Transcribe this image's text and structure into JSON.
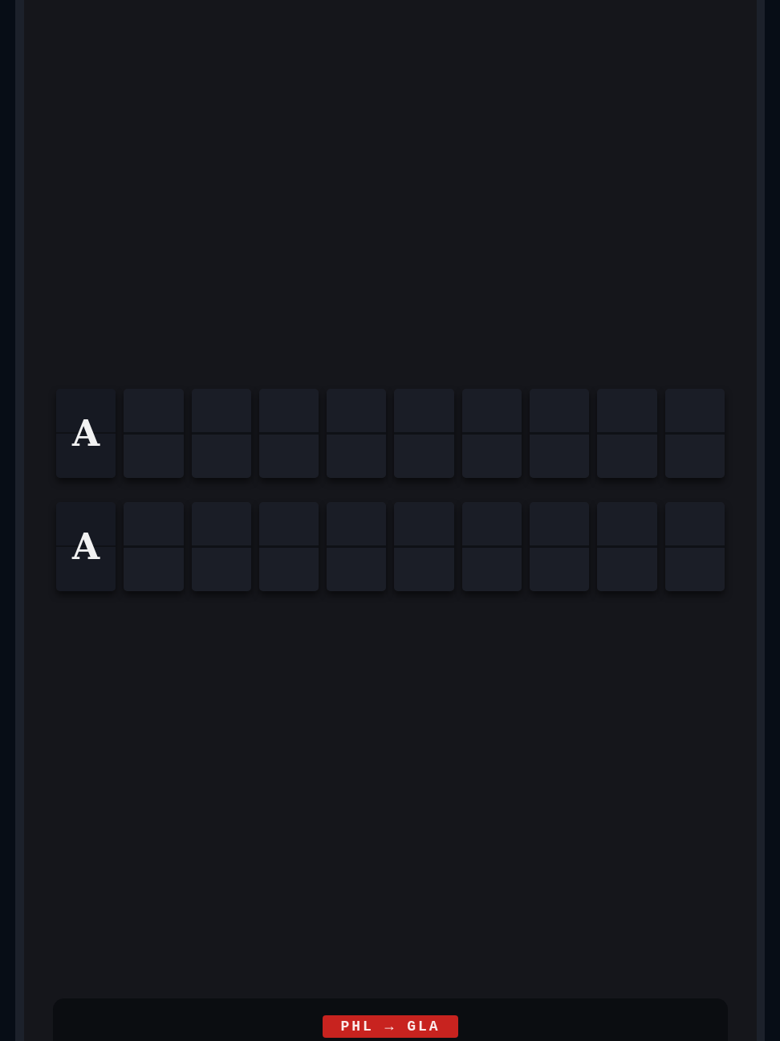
{
  "rows": [
    {
      "tiles": [
        {
          "kind": "letter",
          "text": "A"
        },
        {
          "kind": "blank"
        },
        {
          "kind": "blank"
        },
        {
          "kind": "blank"
        },
        {
          "kind": "blank"
        },
        {
          "kind": "blank"
        },
        {
          "kind": "blank"
        },
        {
          "kind": "blank"
        },
        {
          "kind": "blank"
        },
        {
          "kind": "blank"
        }
      ]
    },
    {
      "tiles": [
        {
          "kind": "letter",
          "text": "A"
        },
        {
          "kind": "blank"
        },
        {
          "kind": "blank"
        },
        {
          "kind": "blank"
        },
        {
          "kind": "blank"
        },
        {
          "kind": "blank"
        },
        {
          "kind": "blank"
        },
        {
          "kind": "blank"
        },
        {
          "kind": "blank"
        },
        {
          "kind": "blank"
        }
      ]
    }
  ],
  "route_badge": {
    "text": "PHL → GLA"
  }
}
